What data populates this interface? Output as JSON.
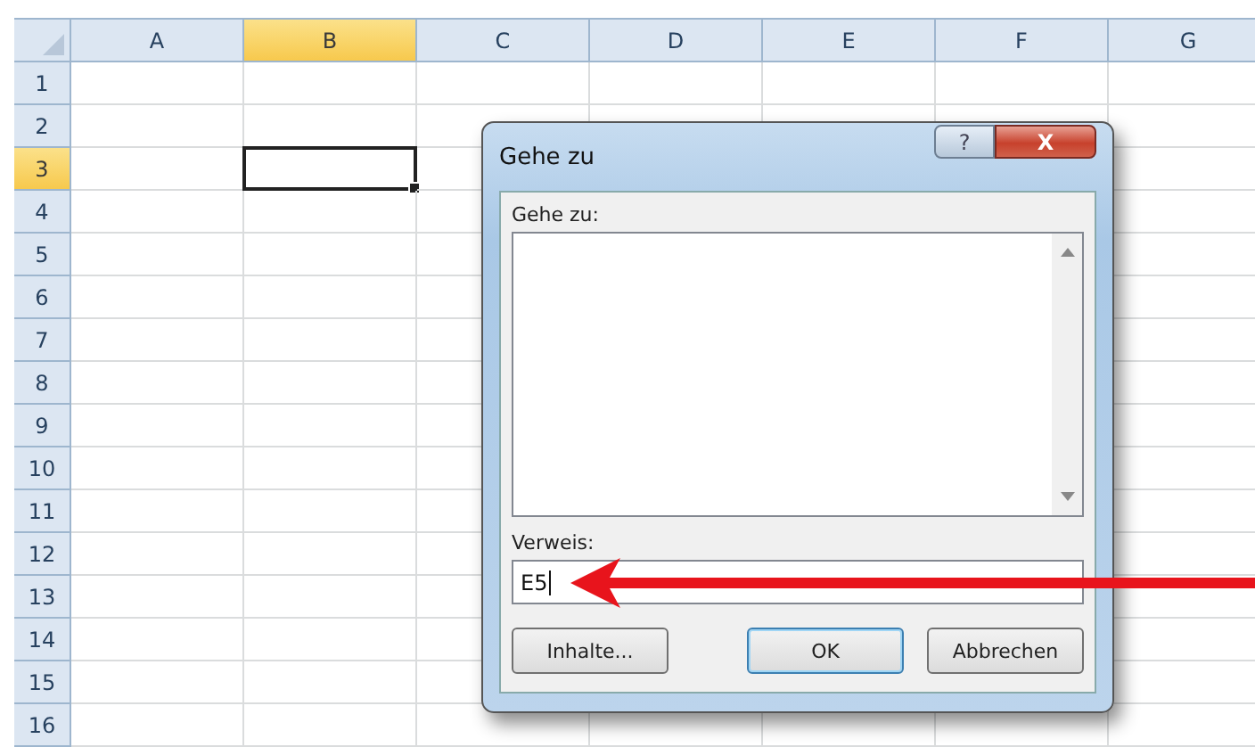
{
  "sheet": {
    "columns": [
      {
        "label": "A",
        "selected": false
      },
      {
        "label": "B",
        "selected": true
      },
      {
        "label": "C",
        "selected": false
      },
      {
        "label": "D",
        "selected": false
      },
      {
        "label": "E",
        "selected": false
      },
      {
        "label": "F",
        "selected": false
      },
      {
        "label": "G",
        "selected": false
      }
    ],
    "rows": [
      {
        "label": "1",
        "selected": false
      },
      {
        "label": "2",
        "selected": false
      },
      {
        "label": "3",
        "selected": true
      },
      {
        "label": "4",
        "selected": false
      },
      {
        "label": "5",
        "selected": false
      },
      {
        "label": "6",
        "selected": false
      },
      {
        "label": "7",
        "selected": false
      },
      {
        "label": "8",
        "selected": false
      },
      {
        "label": "9",
        "selected": false
      },
      {
        "label": "10",
        "selected": false
      },
      {
        "label": "11",
        "selected": false
      },
      {
        "label": "12",
        "selected": false
      },
      {
        "label": "13",
        "selected": false
      },
      {
        "label": "14",
        "selected": false
      },
      {
        "label": "15",
        "selected": false
      },
      {
        "label": "16",
        "selected": false
      }
    ]
  },
  "dialog": {
    "title": "Gehe zu",
    "help_button": "?",
    "close_button": "X",
    "list_label": "Gehe zu:",
    "reference_label": "Verweis:",
    "reference_value": "E5",
    "buttons": [
      {
        "label": "Inhalte...",
        "default": false
      },
      {
        "label": "OK",
        "default": true
      },
      {
        "label": "Abbrechen",
        "default": false
      }
    ]
  }
}
